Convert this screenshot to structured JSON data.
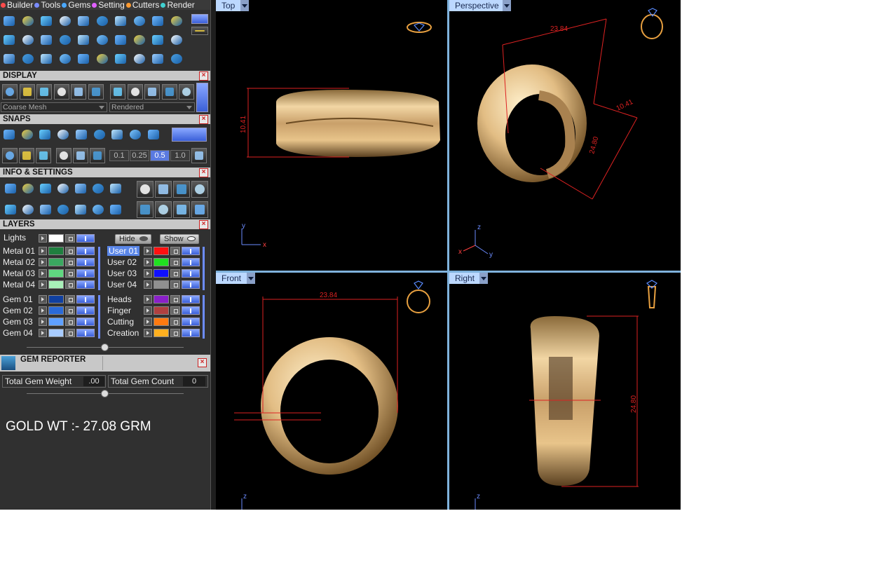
{
  "menubar": {
    "items": [
      {
        "label": "Builder",
        "color": "#ff4b4b"
      },
      {
        "label": "Tools",
        "color": "#7a8cff"
      },
      {
        "label": "Gems",
        "color": "#4aa8ff"
      },
      {
        "label": "Setting",
        "color": "#e060ff"
      },
      {
        "label": "Cutters",
        "color": "#ff9a30"
      },
      {
        "label": "Render",
        "color": "#40d0d0"
      }
    ]
  },
  "sections": {
    "display": "DISPLAY",
    "snaps": "SNAPS",
    "info": "INFO & SETTINGS",
    "layers": "LAYERS",
    "gem_reporter": "GEM REPORTER"
  },
  "display": {
    "mesh_select": "Coarse Mesh",
    "render_select": "Rendered"
  },
  "snaps": {
    "grid_values": [
      "0.1",
      "0.25",
      "0.5",
      "1.0"
    ],
    "active_grid": "0.5"
  },
  "layers": {
    "lights_label": "Lights",
    "lights_color": "#ffffff",
    "hide_label": "Hide",
    "show_label": "Show",
    "left": [
      {
        "label": "Metal 01",
        "color": "#1f7f3f"
      },
      {
        "label": "Metal 02",
        "color": "#3aa860"
      },
      {
        "label": "Metal 03",
        "color": "#5fd880"
      },
      {
        "label": "Metal 04",
        "color": "#a8f0b8"
      },
      {
        "label": "Gem 01",
        "color": "#1040a0"
      },
      {
        "label": "Gem 02",
        "color": "#2a6ad8"
      },
      {
        "label": "Gem 03",
        "color": "#5fa0ff"
      },
      {
        "label": "Gem 04",
        "color": "#a8ccff"
      }
    ],
    "right": [
      {
        "label": "User 01",
        "color": "#ff1010",
        "active": true
      },
      {
        "label": "User 02",
        "color": "#20e020"
      },
      {
        "label": "User 03",
        "color": "#1010ff"
      },
      {
        "label": "User 04",
        "color": "#909090"
      },
      {
        "label": "Heads",
        "color": "#8a20c8"
      },
      {
        "label": "Finger",
        "color": "#b04040"
      },
      {
        "label": "Cutting",
        "color": "#ff7a10"
      },
      {
        "label": "Creation",
        "color": "#ffb020"
      }
    ]
  },
  "gem_reporter": {
    "weight_label": "Total Gem Weight",
    "weight_value": ".00",
    "count_label": "Total Gem Count",
    "count_value": "0"
  },
  "note": {
    "text": "GOLD WT :- 27.08 GRM"
  },
  "viewports": {
    "top": {
      "tab": "Top",
      "dim": "10.41",
      "axis_a": "y",
      "axis_b": "x"
    },
    "perspective": {
      "tab": "Perspective",
      "dim_a": "23.84",
      "dim_b": "10.41",
      "dim_c": "24.80",
      "axis_a": "z",
      "axis_b": "x",
      "axis_c": "y"
    },
    "front": {
      "tab": "Front",
      "dim": "23.84",
      "axis": "z"
    },
    "right": {
      "tab": "Right",
      "dim": "24.80",
      "axis": "z"
    }
  },
  "colors": {
    "viewport_tab": "#bcd8ff",
    "dimension": "#dd2222",
    "metal_gold": "#e8c48a",
    "accent_blue": "#6c8cff"
  }
}
